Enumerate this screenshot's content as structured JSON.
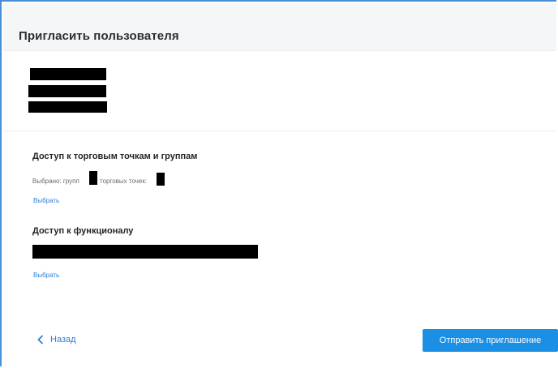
{
  "header": {
    "title": "Пригласить пользователя"
  },
  "sections": {
    "points": {
      "title": "Доступ к торговым точкам и группам",
      "selected_groups_label": "Выбрано: групп",
      "selected_points_label": "торговых точек:",
      "select_link": "Выбрать"
    },
    "functions": {
      "title": "Доступ к функционалу",
      "select_link": "Выбрать"
    }
  },
  "footer": {
    "back_label": "Назад",
    "back_icon": "chevron-left-icon",
    "send_label": "Отправить приглашение"
  },
  "colors": {
    "accent": "#1a8fe3",
    "link": "#2b7fd6",
    "header_bg": "#f5f6f7",
    "frame_border": "#4a90d9"
  }
}
